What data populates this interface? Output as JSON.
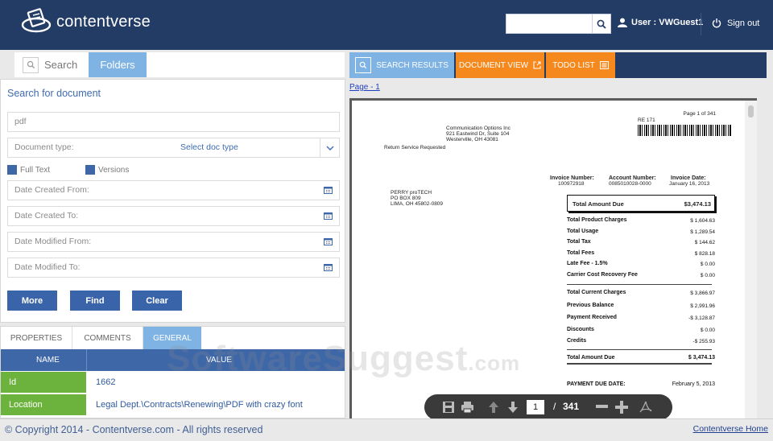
{
  "header": {
    "logo_text": "contentverse",
    "search_value": "",
    "user_label": "User : VWGuest1",
    "signout_label": "Sign out"
  },
  "left_tabs": [
    {
      "label": "Search",
      "icon": "search-icon"
    },
    {
      "label": "Folders"
    }
  ],
  "search_panel": {
    "title": "Search for document",
    "query_value": "pdf",
    "doc_type_label": "Document type:",
    "doc_type_value": "Select doc type",
    "full_text_label": "Full Text",
    "versions_label": "Versions",
    "date_created_from": "Date Created From:",
    "date_created_to": "Date Created To:",
    "date_modified_from": "Date Modified From:",
    "date_modified_to": "Date Modified To:",
    "buttons": {
      "more": "More",
      "find": "Find",
      "clear": "Clear"
    }
  },
  "properties": {
    "tabs": [
      "PROPERTIES",
      "COMMENTS",
      "GENERAL"
    ],
    "active_tab": "GENERAL",
    "columns": [
      "NAME",
      "VALUE"
    ],
    "rows": [
      {
        "name": "Id",
        "value": "1662"
      },
      {
        "name": "Location",
        "value": "Legal Dept.\\Contracts\\Renewing\\PDF with crazy font"
      }
    ]
  },
  "right_tabs": [
    {
      "label": "SEARCH RESULTS"
    },
    {
      "label": "DOCUMENT VIEW"
    },
    {
      "label": "TODO LIST"
    }
  ],
  "page_link": "Page - 1",
  "document": {
    "page_of": "Page 1 of 341",
    "re_code": "RE 171",
    "company": [
      "Communication Options Inc",
      "921 Eastwind Dr, Suite 104",
      "Westerville, OH 43081"
    ],
    "return_service": "Return Service Requested",
    "addressee": [
      "PERRY proTECH",
      "PO BOX 809",
      "LIMA, OH 45802-0809"
    ],
    "invoice_number_label": "Invoice Number:",
    "invoice_number": "100972918",
    "account_number_label": "Account Number:",
    "account_number": "0085010028-0000",
    "invoice_date_label": "Invoice Date:",
    "invoice_date": "January 16, 2013",
    "total_due_label": "Total Amount Due",
    "total_due": "$3,474.13",
    "charges": [
      {
        "label": "Total Product Charges",
        "value": "$ 1,604.63"
      },
      {
        "label": "Total Usage",
        "value": "$ 1,289.54"
      },
      {
        "label": "Total Tax",
        "value": "$ 144.62"
      },
      {
        "label": "Total Fees",
        "value": "$ 828.18"
      },
      {
        "label": "Late Fee - 1.5%",
        "value": "$ 0.00"
      },
      {
        "label": "Carrier Cost Recovery Fee",
        "value": "$ 0.00"
      }
    ],
    "summary": [
      {
        "label": "Total Current Charges",
        "value": "$ 3,866.97"
      },
      {
        "label": "Previous Balance",
        "value": "$ 2,991.96"
      },
      {
        "label": "Payment Received",
        "value": "-$ 3,128.87"
      },
      {
        "label": "Discounts",
        "value": "$ 0.00"
      },
      {
        "label": "Credits",
        "value": "-$ 255.93"
      }
    ],
    "final_total_label": "Total Amount Due",
    "final_total": "$ 3,474.13",
    "payment_due_label": "PAYMENT DUE DATE:",
    "payment_due": "February 5, 2013"
  },
  "viewer_toolbar": {
    "current_page": "1",
    "separator": "/",
    "total_pages": "341"
  },
  "watermark": {
    "text": "SoftwareSuggest",
    "suffix": ".com"
  },
  "footer": {
    "copyright": "© Copyright 2014 - Contentverse.com - All rights reserved",
    "home_link": "Contentverse Home"
  },
  "colors": {
    "header_bg": "#233c66",
    "accent_blue": "#3a64a9",
    "tab_light_blue": "#7fb3e3",
    "tab_orange": "#f5891e",
    "green": "#6cb33e"
  }
}
